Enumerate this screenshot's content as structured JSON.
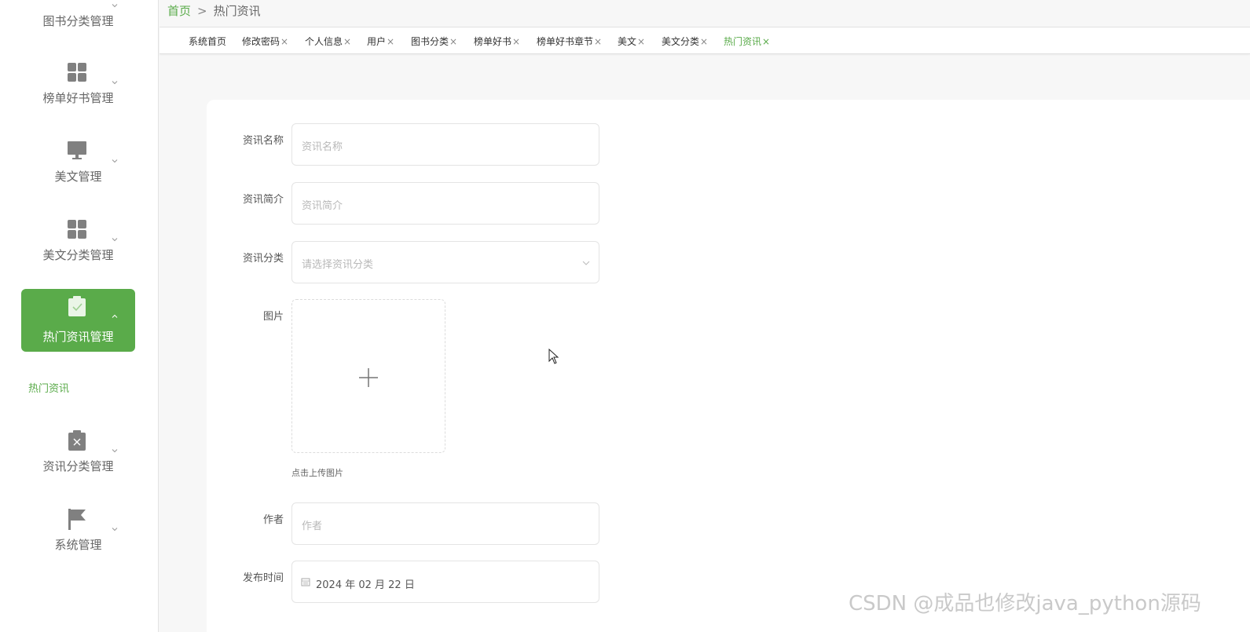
{
  "sidebar": {
    "items": [
      {
        "label": "图书分类管理",
        "icon": "chevron-partial"
      },
      {
        "label": "榜单好书管理",
        "icon": "grid-icon"
      },
      {
        "label": "美文管理",
        "icon": "monitor-icon"
      },
      {
        "label": "美文分类管理",
        "icon": "grid-icon"
      },
      {
        "label": "热门资讯管理",
        "icon": "clipboard-check-icon",
        "active": true
      },
      {
        "label": "资讯分类管理",
        "icon": "clipboard-x-icon"
      },
      {
        "label": "系统管理",
        "icon": "flag-icon"
      }
    ],
    "submenu": {
      "label": "热门资讯"
    },
    "accent": "#5aab4a"
  },
  "breadcrumb": {
    "home": "首页",
    "separator": ">",
    "current": "热门资讯"
  },
  "tabs": [
    {
      "label": "系统首页",
      "closable": false
    },
    {
      "label": "修改密码",
      "closable": true
    },
    {
      "label": "个人信息",
      "closable": true
    },
    {
      "label": "用户",
      "closable": true
    },
    {
      "label": "图书分类",
      "closable": true
    },
    {
      "label": "榜单好书",
      "closable": true
    },
    {
      "label": "榜单好书章节",
      "closable": true
    },
    {
      "label": "美文",
      "closable": true
    },
    {
      "label": "美文分类",
      "closable": true
    },
    {
      "label": "热门资讯",
      "closable": true,
      "active": true
    }
  ],
  "tab_close_glyph": "×",
  "form": {
    "name": {
      "label": "资讯名称",
      "placeholder": "资讯名称"
    },
    "summary": {
      "label": "资讯简介",
      "placeholder": "资讯简介"
    },
    "category": {
      "label": "资讯分类",
      "placeholder": "请选择资讯分类"
    },
    "image": {
      "label": "图片",
      "hint": "点击上传图片"
    },
    "author": {
      "label": "作者",
      "placeholder": "作者"
    },
    "publish_time": {
      "label": "发布时间",
      "value": "2024 年 02 月 22 日"
    }
  },
  "watermark": "CSDN @成品也修改java_python源码"
}
